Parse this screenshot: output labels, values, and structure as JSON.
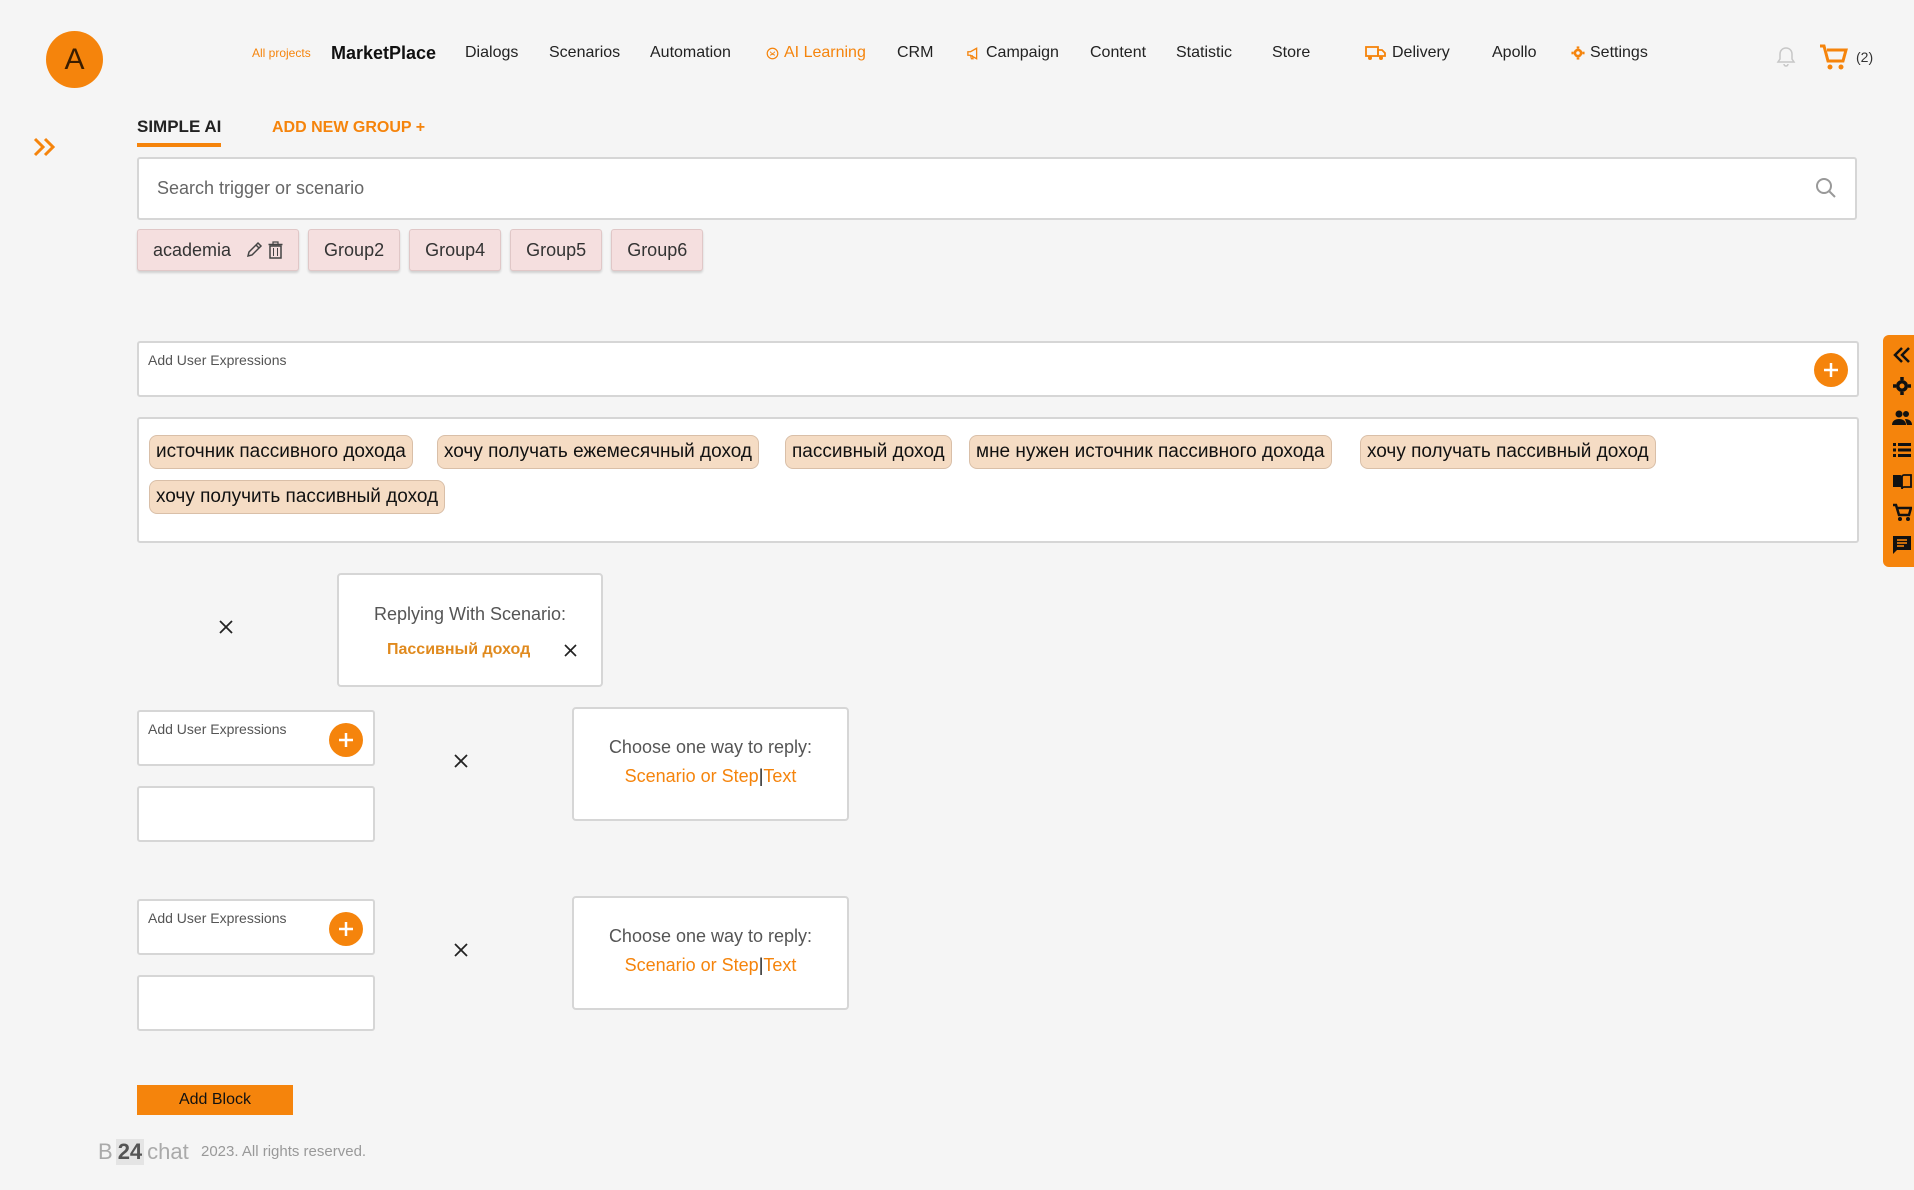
{
  "header": {
    "avatar_letter": "A",
    "nav": {
      "all_projects": "All projects",
      "marketplace": "MarketPlace",
      "dialogs": "Dialogs",
      "scenarios": "Scenarios",
      "automation": "Automation",
      "ai_learning": "AI Learning",
      "crm": "CRM",
      "campaign": "Campaign",
      "content": "Content",
      "statistic": "Statistic",
      "store": "Store",
      "delivery": "Delivery",
      "apollo": "Apollo",
      "settings": "Settings"
    },
    "cart_count": "(2)",
    "accent_color": "#f5840c"
  },
  "tabs": {
    "simple_ai": "SIMPLE AI",
    "add_group": "ADD NEW GROUP +"
  },
  "search": {
    "placeholder": "Search trigger or scenario",
    "value": ""
  },
  "groups": [
    "academia",
    "Group2",
    "Group4",
    "Group5",
    "Group6"
  ],
  "block1": {
    "input_label": "Add User Expressions",
    "expressions": [
      "источник пассивного дохода",
      "хочу получать ежемесячный доход",
      "пассивный доход",
      "мне нужен источник пассивного дохода",
      "хочу получать пассивный доход",
      "хочу получить пассивный доход"
    ],
    "reply_title": "Replying With Scenario:",
    "scenario_name": "Пассивный доход"
  },
  "block2": {
    "input_label": "Add User Expressions",
    "reply_title": "Choose one way to reply:",
    "link_scenario": "Scenario or Step",
    "separator": "|",
    "link_text": "Text"
  },
  "block3": {
    "input_label": "Add User Expressions",
    "reply_title": "Choose one way to reply:",
    "link_scenario": "Scenario or Step",
    "separator": "|",
    "link_text": "Text"
  },
  "add_block_label": "Add Block",
  "footer": {
    "logo_b": "B",
    "logo_num": "24",
    "logo_chat": "chat",
    "copyright": "2023. All rights reserved."
  }
}
